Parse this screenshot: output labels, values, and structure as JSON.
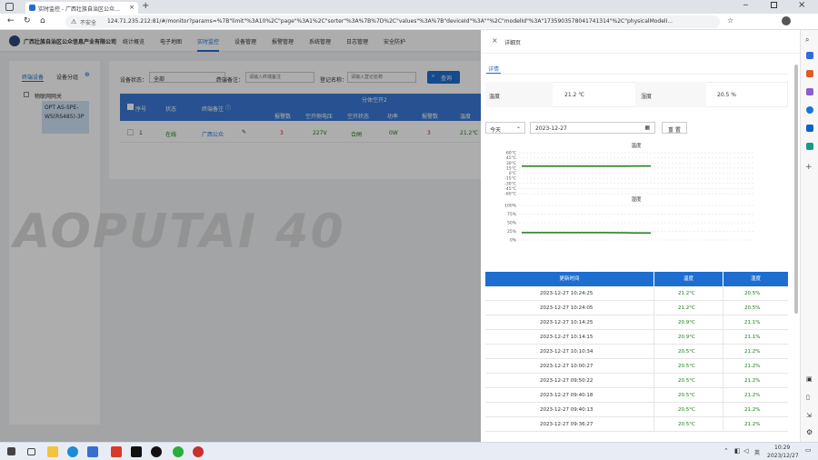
{
  "browser": {
    "tab_title": "实时监控 - 广西壮族自治区公众…",
    "insecure_label": "不安全",
    "url": "124.71.235.212:81/#/monitor?params=%7B\"limit\"%3A10%2C\"page\"%3A1%2C\"sorter\"%3A%7B%7D%2C\"values\"%3A%7B\"deviceId\"%3A\"\"%2C\"modelId\"%3A\"1735903578041741314\"%2C\"physicalModelI..."
  },
  "app": {
    "org_name": "广西壮族自治区公众信息产业有限公司",
    "nav": [
      "统计概览",
      "电子地图",
      "实时监控",
      "设备管理",
      "报警管理",
      "系统管理",
      "日志管理",
      "安全防护"
    ],
    "active_nav": "实时监控",
    "watermark": "AOPUTAI 40"
  },
  "sidebar": {
    "tabs": [
      "终端设备",
      "设备分组"
    ],
    "tree_root": "物联网网关",
    "tree_child": "OPT AS-SPE-WS(RS485)-3P"
  },
  "filters": {
    "status_label": "设备状态：",
    "status_value": "全部",
    "remark_label": "终端备注：",
    "remark_placeholder": "请输入终端备注",
    "name_label": "登记名称：",
    "name_placeholder": "请输入登记名称",
    "search_button": "查询"
  },
  "table": {
    "group_header": "分体空开2",
    "headers": [
      "序号",
      "状态",
      "终端备注",
      "报警数",
      "空开侧电压",
      "空开状态",
      "功率",
      "报警数",
      "温度"
    ],
    "row": [
      "1",
      "在线",
      "广西公众",
      "3",
      "227V",
      "合闸",
      "0W",
      "3",
      "21.2℃"
    ]
  },
  "drawer": {
    "title": "详细页",
    "tab": "详情",
    "temp_label": "温度",
    "temp_value": "21.2 ℃",
    "humid_label": "湿度",
    "humid_value": "20.5 %",
    "range_select": "今天",
    "date_value": "2023-12-27",
    "reset_button": "重 置",
    "table_headers": [
      "更新时间",
      "温度",
      "湿度"
    ],
    "rows": [
      [
        "2023-12-27 10:24:25",
        "21.2°C",
        "20.5%"
      ],
      [
        "2023-12-27 10:24:05",
        "21.2°C",
        "20.5%"
      ],
      [
        "2023-12-27 10:14:25",
        "20.9°C",
        "21.1%"
      ],
      [
        "2023-12-27 10:14:15",
        "20.9°C",
        "21.1%"
      ],
      [
        "2023-12-27 10:10:34",
        "20.5°C",
        "21.2%"
      ],
      [
        "2023-12-27 10:00:27",
        "20.5°C",
        "21.2%"
      ],
      [
        "2023-12-27 09:50:22",
        "20.5°C",
        "21.2%"
      ],
      [
        "2023-12-27 09:40:18",
        "20.5°C",
        "21.2%"
      ],
      [
        "2023-12-27 09:40:13",
        "20.5°C",
        "21.2%"
      ],
      [
        "2023-12-27 09:36:27",
        "20.5°C",
        "21.2%"
      ]
    ]
  },
  "chart_data": [
    {
      "type": "line",
      "title": "温度",
      "ytick_labels": [
        "60°C",
        "45°C",
        "30°C",
        "15°C",
        "0°C",
        "-15°C",
        "-30°C",
        "-45°C",
        "-60°C"
      ],
      "ylim": [
        -60,
        60
      ],
      "series": [
        {
          "values": [
            20.5,
            20.5,
            20.5,
            20.5,
            20.5,
            20.5,
            20.5,
            20.9,
            21.2,
            21.2
          ]
        }
      ],
      "color": "#1a7a1a"
    },
    {
      "type": "line",
      "title": "湿度",
      "ytick_labels": [
        "100%",
        "75%",
        "50%",
        "25%",
        "0%"
      ],
      "ylim": [
        0,
        100
      ],
      "series": [
        {
          "values": [
            21.2,
            21.2,
            21.2,
            21.2,
            21.2,
            21.2,
            21.2,
            21.1,
            20.5,
            20.5
          ]
        }
      ],
      "color": "#1a7a1a"
    }
  ],
  "taskbar": {
    "time": "10:29",
    "date": "2023/12/27",
    "lang": "英"
  }
}
